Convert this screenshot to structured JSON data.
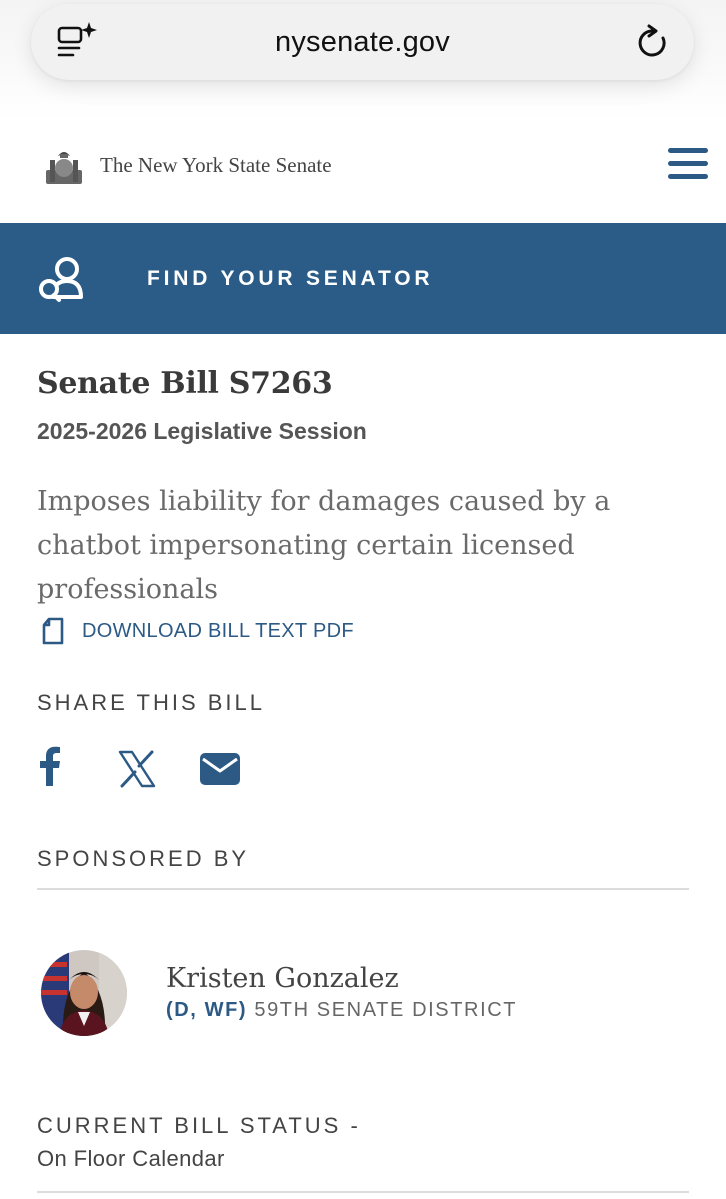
{
  "browser": {
    "url": "nysenate.gov",
    "reader_icon": "reader-sparkle-icon",
    "reload_icon": "reload-icon"
  },
  "site": {
    "name": "The New York State Senate",
    "logo_icon": "ny-state-seal-icon",
    "menu_icon": "hamburger-menu-icon"
  },
  "banner": {
    "label": "FIND YOUR SENATOR",
    "icon": "senator-search-icon",
    "background": "#2b5c88"
  },
  "bill": {
    "title": "Senate Bill S7263",
    "session": "2025-2026 Legislative Session",
    "summary": "Imposes liability for damages caused by a chatbot impersonating certain licensed professionals",
    "download_label": "DOWNLOAD BILL TEXT PDF"
  },
  "share": {
    "heading": "SHARE THIS BILL",
    "icons": [
      "facebook-icon",
      "x-icon",
      "email-icon"
    ]
  },
  "sponsor": {
    "heading": "SPONSORED BY",
    "name": "Kristen Gonzalez",
    "party": "(D, WF)",
    "district": "59TH SENATE DISTRICT"
  },
  "status": {
    "heading": "CURRENT BILL STATUS -",
    "value": "On Floor Calendar"
  },
  "colors": {
    "accent": "#2c5a85",
    "text": "#4a4a4a"
  }
}
